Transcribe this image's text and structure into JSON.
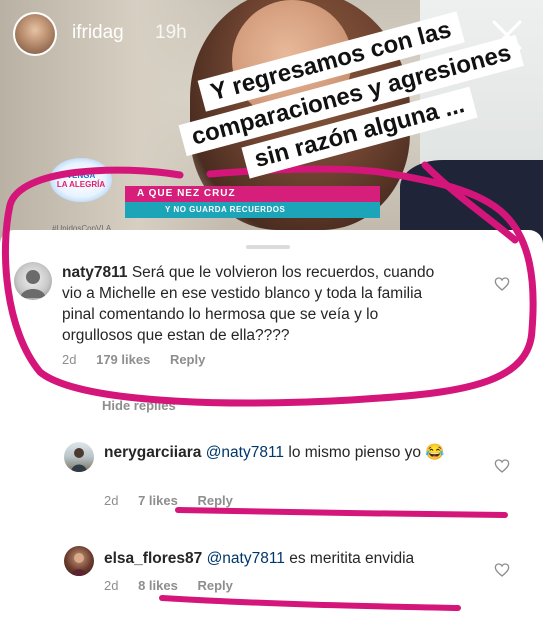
{
  "story": {
    "username": "ifridag",
    "time": "19h",
    "caption_lines": [
      "Y regresamos con las",
      "comparaciones y agresiones",
      "sin razón alguna ..."
    ],
    "tv_logo": {
      "line1": "VENGA",
      "line2": "LA ALEGRÍA"
    },
    "tv_hashtag": "#UnidosConVLA",
    "banner_top": "A     QUE          NEZ CRUZ",
    "banner_bottom": "Y NO GUARDA       RECUERDOS"
  },
  "comments": [
    {
      "username": "naty7811",
      "text": "Será que le volvieron los recuerdos, cuando vio a Michelle en ese vestido blanco y toda la familia pinal comentando lo hermosa que se veía y lo orgullosos que estan de ella????",
      "time": "2d",
      "likes": "179 likes",
      "reply": "Reply"
    }
  ],
  "hide_replies": "Hide replies",
  "replies": [
    {
      "username": "nerygarciiara",
      "mention": "@naty7811",
      "text": "lo mismo pienso yo 😂",
      "time": "2d",
      "likes": "7 likes",
      "reply": "Reply"
    },
    {
      "username": "elsa_flores87",
      "mention": "@naty7811",
      "text": "es meritita envidia",
      "time": "2d",
      "likes": "8 likes",
      "reply": "Reply"
    }
  ],
  "colors": {
    "annotation_magenta": "#d4157a",
    "meta_gray": "#8e8e8e",
    "mention_blue": "#00376b"
  }
}
